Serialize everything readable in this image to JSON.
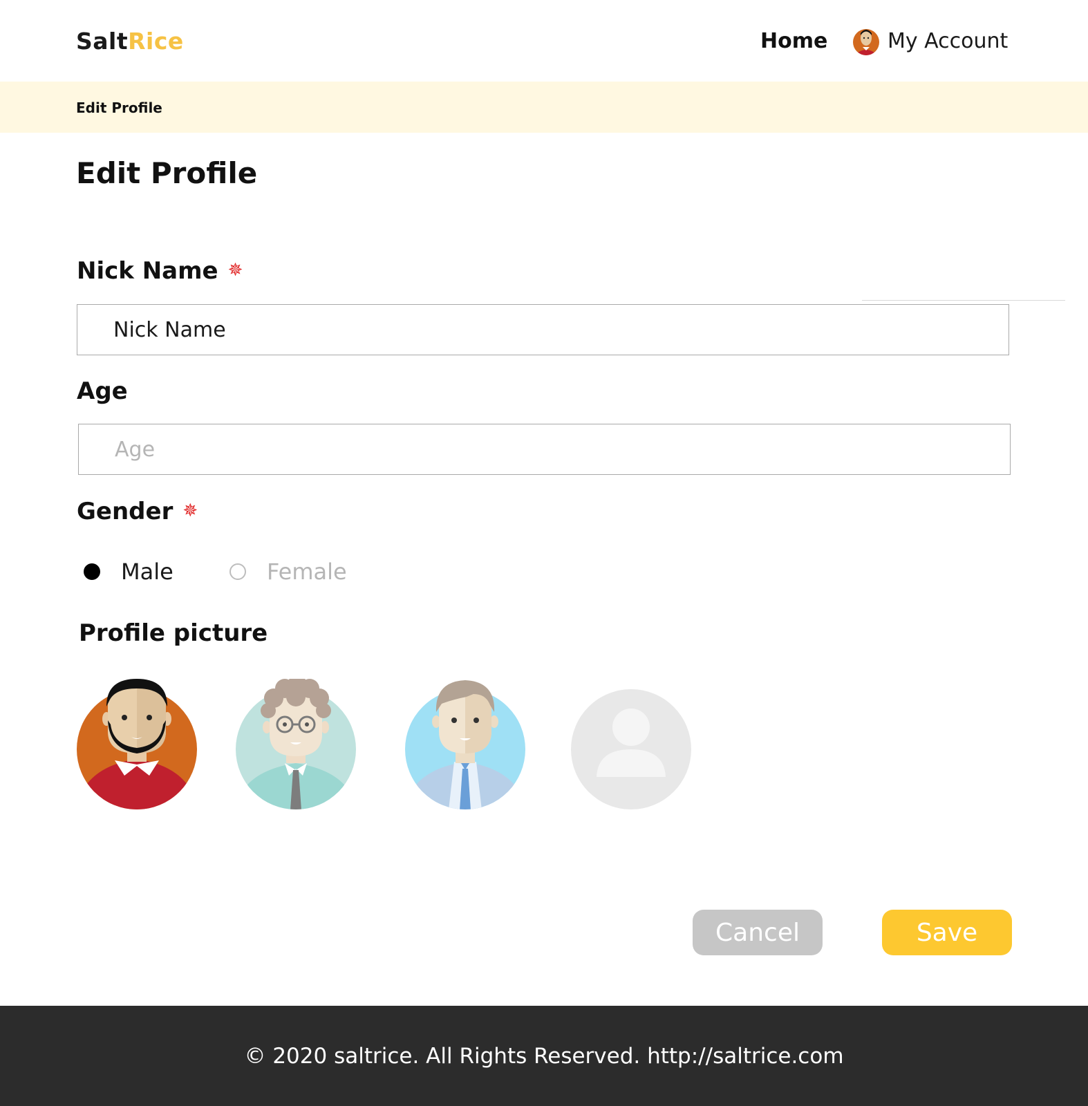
{
  "header": {
    "logo_part1": "Salt",
    "logo_part2": "Rice",
    "nav_home": "Home",
    "nav_account": "My Account"
  },
  "breadcrumb": "Edit Profile",
  "page_title": "Edit Profile",
  "form": {
    "nickname_label": "Nick Name",
    "nickname_value": "Nick Name",
    "age_label": "Age",
    "age_placeholder": "Age",
    "gender_label": "Gender",
    "gender_options": [
      "Male",
      "Female"
    ],
    "gender_selected": "Male",
    "profile_picture_label": "Profile picture",
    "required_mark": "✵"
  },
  "avatars": [
    "man-beard-red-sweater",
    "woman-curly-hair-glasses",
    "man-business-suit",
    "default-placeholder"
  ],
  "buttons": {
    "cancel": "Cancel",
    "save": "Save"
  },
  "footer": {
    "text": "© 2020 saltrice. All Rights Reserved. http://saltrice.com"
  },
  "colors": {
    "accent": "#fdc830",
    "logo_accent": "#f6c244",
    "breadcrumb_bg": "#fff8e1",
    "required": "#e02020",
    "footer_bg": "#2c2c2c",
    "cancel_bg": "#c6c6c6"
  }
}
